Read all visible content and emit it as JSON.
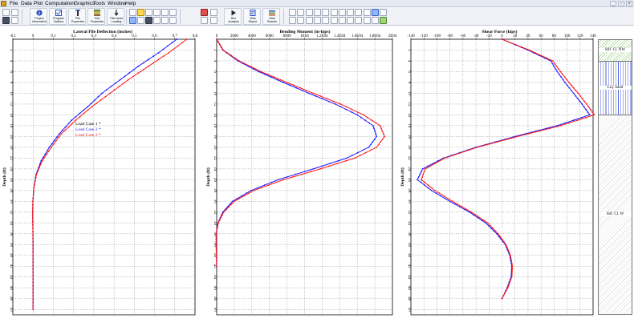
{
  "menu": {
    "items": [
      "File",
      "Data",
      "Plot",
      "Computation",
      "Graphics",
      "Tools",
      "Window",
      "Help"
    ],
    "window_buttons": [
      "_",
      "▫",
      "×"
    ]
  },
  "toolbar": {
    "big_buttons": [
      {
        "line1": "Project",
        "line2": "Information",
        "icon": "info-icon",
        "color": "#2a4ec0"
      },
      {
        "line1": "Program",
        "line2": "Options",
        "icon": "options-icon",
        "color": "#2a4ec0"
      },
      {
        "line1": "Pile",
        "line2": "Properties",
        "icon": "pile-icon",
        "color": "#2a2a2a"
      },
      {
        "line1": "Soil",
        "line2": "Properties",
        "icon": "soil-icon",
        "color": "#5a8a2a"
      },
      {
        "line1": "Pile-head",
        "line2": "Loading",
        "icon": "loading-icon",
        "color": "#2a2a2a"
      },
      {
        "line1": "Run",
        "line2": "Analysis",
        "icon": "run-icon",
        "color": "#2a2a2a"
      },
      {
        "line1": "View",
        "line2": "Report",
        "icon": "report-icon",
        "color": "#2a4ec0"
      },
      {
        "line1": "View",
        "line2": "Results",
        "icon": "results-icon",
        "color": "#2a4ec0"
      }
    ]
  },
  "plots": {
    "deflection": {
      "title": "Lateral Pile Deflection (inches)",
      "x_ticks": [
        "-0.1",
        "0",
        "0.1",
        "0.2",
        "0.3",
        "0.4",
        "0.5",
        "0.6",
        "0.7",
        "0.8"
      ],
      "x_values": [
        -0.1,
        0,
        0.1,
        0.2,
        0.3,
        0.4,
        0.5,
        0.6,
        0.7,
        0.8
      ],
      "ylabel": "Depth (ft)"
    },
    "moment": {
      "title": "Bending Moment (in-kips)",
      "x_ticks": [
        "0",
        "2000",
        "4000",
        "6000",
        "8000",
        "1E04",
        "1.2E04",
        "1.4E04",
        "1.6E04",
        "1.8E04",
        "2E04"
      ],
      "x_values": [
        0,
        2000,
        4000,
        6000,
        8000,
        10000,
        12000,
        14000,
        16000,
        18000,
        20000
      ],
      "ylabel": "Depth (ft)"
    },
    "shear": {
      "title": "Shear Force (kips)",
      "x_ticks": [
        "-140",
        "-120",
        "-100",
        "-80",
        "-60",
        "-40",
        "-20",
        "0",
        "20",
        "40",
        "60",
        "80",
        "100",
        "120",
        "140"
      ],
      "x_values": [
        -140,
        -120,
        -100,
        -80,
        -60,
        -40,
        -20,
        0,
        20,
        40,
        60,
        80,
        100,
        120,
        140
      ],
      "ylabel": "Depth (ft)"
    },
    "depth_ticks": [
      "0",
      "2",
      "4",
      "6",
      "8",
      "10",
      "12",
      "14",
      "16",
      "18",
      "20",
      "22",
      "24",
      "26",
      "28",
      "30",
      "32",
      "34",
      "36",
      "38",
      "40",
      "42",
      "44",
      "46",
      "48",
      "50"
    ],
    "depth_values": [
      0,
      2,
      4,
      6,
      8,
      10,
      12,
      14,
      16,
      18,
      20,
      22,
      24,
      26,
      28,
      30,
      32,
      34,
      36,
      38,
      40,
      42,
      44,
      46,
      48,
      50
    ]
  },
  "legend": [
    {
      "label": "Load Case 1",
      "color": "#000000",
      "marker": "*"
    },
    {
      "label": "Load Case 2",
      "color": "#1a1aff",
      "marker": "*"
    },
    {
      "label": "Load Case 3",
      "color": "#ff1a1a",
      "marker": "*"
    }
  ],
  "soil_layers": [
    {
      "label": "Stif. Cl. NW",
      "top": 0,
      "bottom": 4,
      "pattern": "green-hatch"
    },
    {
      "label": "Liq. Sand",
      "top": 4,
      "bottom": 14,
      "pattern": "blue-vertical"
    },
    {
      "label": "Stif. Cl. W",
      "top": 14,
      "bottom": 51,
      "pattern": "gray-hatch"
    }
  ],
  "chart_data": [
    {
      "type": "line",
      "title": "Lateral Pile Deflection (inches)",
      "xlabel": "",
      "ylabel": "Depth (ft)",
      "xlim": [
        -0.1,
        0.8
      ],
      "ylim": [
        50,
        0
      ],
      "series": [
        {
          "name": "Load Case 2",
          "color": "#1a1aff",
          "x": [
            0.71,
            0.62,
            0.52,
            0.43,
            0.34,
            0.27,
            0.19,
            0.13,
            0.08,
            0.04,
            0.015,
            0.004,
            -0.001,
            -0.002,
            -0.001,
            0,
            0,
            0,
            0,
            0,
            0
          ],
          "y": [
            0,
            2.5,
            5,
            7.5,
            10,
            12.5,
            15,
            17.5,
            20,
            22.5,
            25,
            27.5,
            30,
            32.5,
            35,
            37.5,
            40,
            42.5,
            45,
            47.5,
            50
          ]
        },
        {
          "name": "Load Case 3",
          "color": "#ff1a1a",
          "x": [
            0.76,
            0.67,
            0.57,
            0.47,
            0.38,
            0.29,
            0.21,
            0.14,
            0.09,
            0.045,
            0.017,
            0.004,
            -0.001,
            -0.002,
            -0.001,
            0,
            0,
            0,
            0,
            0,
            0
          ],
          "y": [
            0,
            2.5,
            5,
            7.5,
            10,
            12.5,
            15,
            17.5,
            20,
            22.5,
            25,
            27.5,
            30,
            32.5,
            35,
            37.5,
            40,
            42.5,
            45,
            47.5,
            50
          ]
        }
      ]
    },
    {
      "type": "line",
      "title": "Bending Moment (in-kips)",
      "xlabel": "",
      "ylabel": "Depth (ft)",
      "xlim": [
        0,
        20000
      ],
      "ylim": [
        50,
        0
      ],
      "series": [
        {
          "name": "Load Case 2",
          "color": "#1a1aff",
          "x": [
            0,
            700,
            2400,
            4800,
            7600,
            10500,
            13500,
            16000,
            17800,
            18200,
            17300,
            14800,
            11000,
            7000,
            3900,
            1800,
            700,
            150,
            -50,
            -50,
            -20,
            0
          ],
          "y": [
            0,
            2,
            4,
            6,
            8,
            10,
            12,
            14,
            16,
            18,
            20,
            22,
            24,
            26,
            28,
            30,
            32,
            34,
            36,
            38,
            40,
            42
          ]
        },
        {
          "name": "Load Case 3",
          "color": "#ff1a1a",
          "x": [
            0,
            750,
            2550,
            5050,
            8000,
            11000,
            14100,
            16700,
            18600,
            19100,
            18200,
            15700,
            11800,
            7600,
            4200,
            2000,
            800,
            180,
            -60,
            -60,
            -25,
            0
          ],
          "y": [
            0,
            2,
            4,
            6,
            8,
            10,
            12,
            14,
            16,
            18,
            20,
            22,
            24,
            26,
            28,
            30,
            32,
            34,
            36,
            38,
            40,
            42
          ]
        }
      ]
    },
    {
      "type": "line",
      "title": "Shear Force (kips)",
      "xlabel": "",
      "ylabel": "Depth (ft)",
      "xlim": [
        -140,
        140
      ],
      "ylim": [
        50,
        0
      ],
      "series": [
        {
          "name": "Load Case 2",
          "color": "#1a1aff",
          "x": [
            0,
            40,
            75,
            85,
            97,
            110,
            123,
            135,
            85,
            20,
            -40,
            -90,
            -122,
            -130,
            -108,
            -80,
            -50,
            -25,
            -8,
            5,
            12,
            15,
            14,
            8,
            0
          ],
          "y": [
            0,
            2,
            4,
            6,
            8,
            10,
            12,
            14,
            16,
            18,
            20,
            22,
            24,
            26,
            28,
            30,
            32,
            34,
            36,
            38,
            40,
            42,
            44,
            46,
            48
          ]
        },
        {
          "name": "Load Case 3",
          "color": "#ff1a1a",
          "x": [
            0,
            42,
            78,
            90,
            103,
            117,
            130,
            142,
            90,
            24,
            -38,
            -88,
            -118,
            -124,
            -103,
            -76,
            -47,
            -22,
            -6,
            6,
            13,
            16,
            15,
            9,
            0
          ],
          "y": [
            0,
            2,
            4,
            6,
            8,
            10,
            12,
            14,
            16,
            18,
            20,
            22,
            24,
            26,
            28,
            30,
            32,
            34,
            36,
            38,
            40,
            42,
            44,
            46,
            48
          ]
        }
      ]
    }
  ]
}
